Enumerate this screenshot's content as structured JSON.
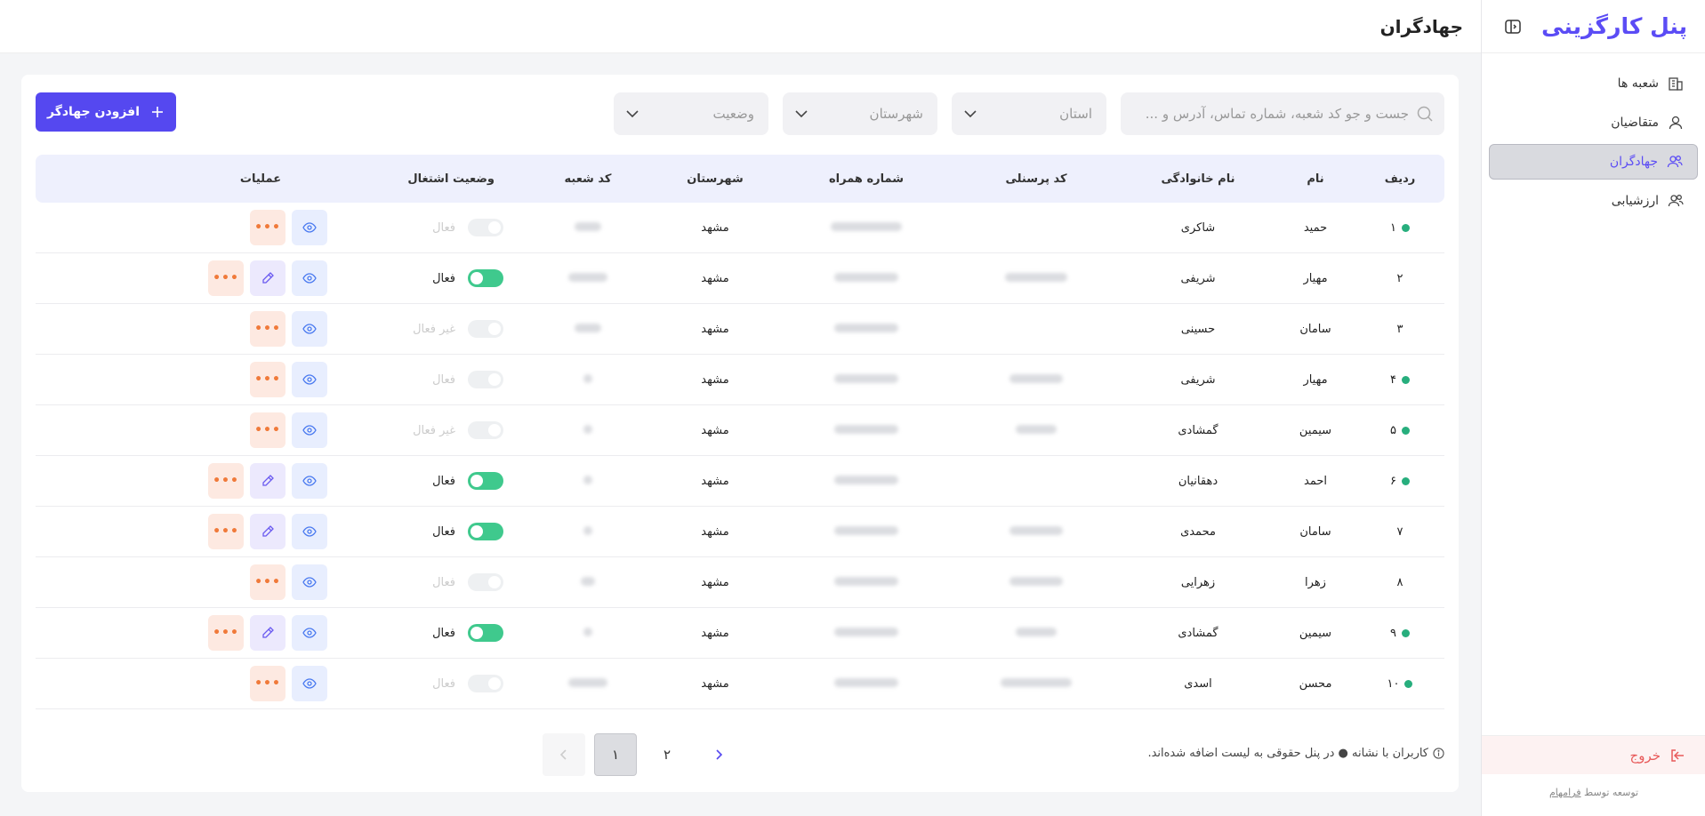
{
  "sidebar": {
    "logo": "پنل کارگزینی",
    "items": [
      {
        "label": "شعبه ها",
        "icon": "building-icon",
        "active": false
      },
      {
        "label": "متقاضیان",
        "icon": "user-icon",
        "active": false
      },
      {
        "label": "جهادگران",
        "icon": "users-icon",
        "active": true
      },
      {
        "label": "ارزشیابی",
        "icon": "users-icon",
        "active": false
      }
    ],
    "logout_label": "خروج",
    "credit_prefix": "توسعه توسط",
    "credit_name": "فرامهام"
  },
  "header": {
    "title": "جهادگران"
  },
  "filters": {
    "search_placeholder": "جست و جو کد شعبه، شماره تماس، آدرس و ...",
    "state_label": "استان",
    "city_label": "شهرستان",
    "status_label": "وضعیت",
    "add_button_label": "افزودن جهادگر"
  },
  "table": {
    "columns": [
      "ردیف",
      "نام",
      "نام خانوادگی",
      "کد پرسنلی",
      "شماره همراه",
      "شهرستان",
      "کد شعبه",
      "وضعیت اشتغال",
      "عملیات"
    ],
    "rows": [
      {
        "idx": "۱",
        "dot": true,
        "name": "حمید",
        "family": "شاکری",
        "city": "مشهد",
        "status": "فعال",
        "active": false
      },
      {
        "idx": "۲",
        "dot": false,
        "name": "مهیار",
        "family": "شریفی",
        "city": "مشهد",
        "status": "فعال",
        "active": true
      },
      {
        "idx": "۳",
        "dot": false,
        "name": "سامان",
        "family": "حسینی",
        "city": "مشهد",
        "status": "غیر فعال",
        "active": false
      },
      {
        "idx": "۴",
        "dot": true,
        "name": "مهیار",
        "family": "شریفی",
        "city": "مشهد",
        "status": "فعال",
        "active": false
      },
      {
        "idx": "۵",
        "dot": true,
        "name": "سیمین",
        "family": "گمشادی",
        "city": "مشهد",
        "status": "غیر فعال",
        "active": false
      },
      {
        "idx": "۶",
        "dot": true,
        "name": "احمد",
        "family": "دهقانیان",
        "city": "مشهد",
        "status": "فعال",
        "active": true
      },
      {
        "idx": "۷",
        "dot": false,
        "name": "سامان",
        "family": "محمدی",
        "city": "مشهد",
        "status": "فعال",
        "active": true
      },
      {
        "idx": "۸",
        "dot": false,
        "name": "زهرا",
        "family": "زهرایی",
        "city": "مشهد",
        "status": "فعال",
        "active": false
      },
      {
        "idx": "۹",
        "dot": true,
        "name": "سیمین",
        "family": "گمشادی",
        "city": "مشهد",
        "status": "فعال",
        "active": true
      },
      {
        "idx": "۱۰",
        "dot": true,
        "name": "محسن",
        "family": "اسدی",
        "city": "مشهد",
        "status": "فعال",
        "active": false
      }
    ]
  },
  "footer": {
    "note": "کاربران با نشانه ● در پنل حقوقی به لیست اضافه شده‌اند.",
    "pages": [
      "۱",
      "۲"
    ],
    "current_page": "۱"
  },
  "colors": {
    "accent": "#5548f0",
    "dot": "#27ae7d",
    "toggle_on": "#3fc98d",
    "more": "#f07a3a"
  }
}
